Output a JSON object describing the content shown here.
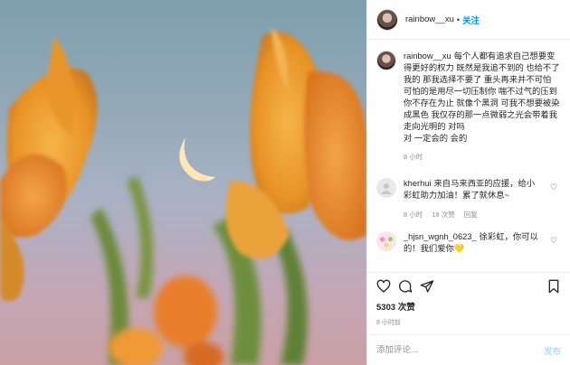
{
  "header": {
    "username": "rainbow__xu",
    "separator": "•",
    "follow_label": "关注"
  },
  "caption": {
    "username": "rainbow__xu",
    "text": "每个人都有追求自己想要变得更好的权力 既然是我追不到的 也给不了我的 那我选择不要了 重头再来并不可怕 可怕的是用尽一切压制你 喘不过气的压到你不存在为止 就像个黑洞 可我不想要被染成黑色 我仅存的那一点微弱之光会带着我走向光明的 对吗",
    "text2": "对 一定会的 会的",
    "time": "8 小时"
  },
  "comments": [
    {
      "username": "kherhui",
      "text": "来自马来西亚的应援，给小彩虹助力加油！累了就休息~",
      "time": "8 小时",
      "likes": "18 次赞",
      "reply": "回复"
    },
    {
      "username": "_hjsn_wgnh_0623_",
      "text": "徐彩虹，你可以的！我们爱你💛"
    }
  ],
  "likes": "5303 次赞",
  "posted_ago": "8 小时前",
  "add_comment": {
    "placeholder": "添加评论...",
    "post_label": "发布"
  },
  "colors": {
    "link": "#0095f6",
    "post_disabled": "#b2dffc",
    "muted": "#8e8e8e"
  }
}
